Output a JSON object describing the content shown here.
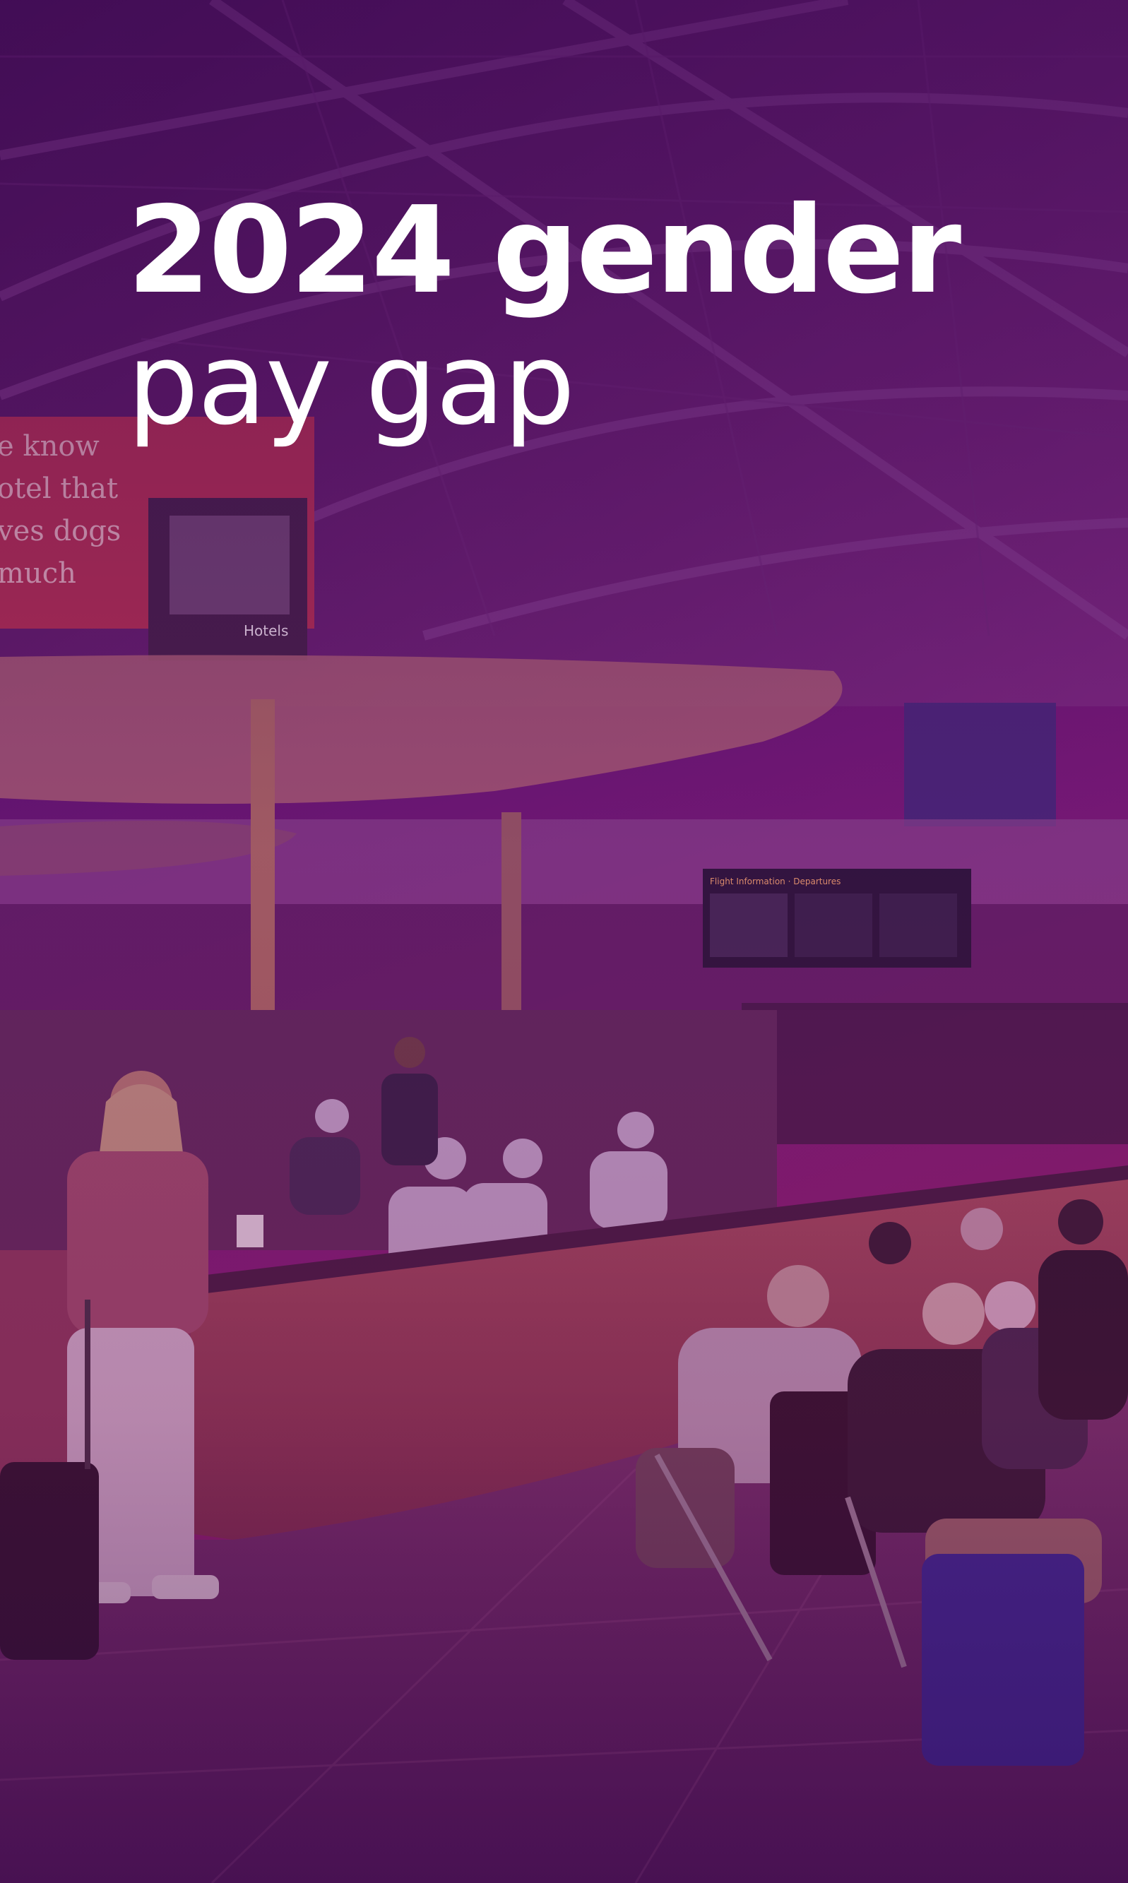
{
  "headline": {
    "line1": "2024 gender",
    "line2": "pay gap"
  },
  "scene": {
    "billboard_lines": [
      "e know",
      "otel that",
      "ves dogs",
      "much"
    ],
    "billboard_brand": "Hotels",
    "departure_board": "Flight Information · Departures"
  },
  "colors": {
    "overlay_top": "#4a1260",
    "overlay_bottom": "#8a1e6a",
    "text": "#ffffff"
  }
}
